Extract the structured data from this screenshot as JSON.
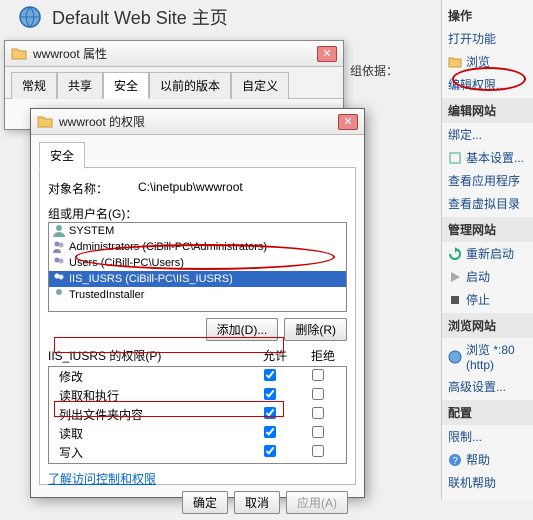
{
  "main": {
    "title": "Default Web Site 主页"
  },
  "depends_text": "组依据：",
  "props_dialog": {
    "title": "wwwroot 属性",
    "tabs": [
      "常规",
      "共享",
      "安全",
      "以前的版本",
      "自定义"
    ]
  },
  "perm_dialog": {
    "title": "wwwroot 的权限",
    "tab": "安全",
    "object_label": "对象名称：",
    "object_value": "C:\\inetpub\\wwwroot",
    "groups_label": "组或用户名(G)：",
    "groups": [
      {
        "name": "SYSTEM"
      },
      {
        "name": "Administrators (CiBill-PC\\Administrators)"
      },
      {
        "name": "Users (CiBill-PC\\Users)"
      },
      {
        "name": "IIS_IUSRS (CiBill-PC\\IIS_IUSRS)",
        "selected": true
      },
      {
        "name": "TrustedInstaller"
      }
    ],
    "add_btn": "添加(D)...",
    "remove_btn": "删除(R)",
    "perm_label_tpl": "IIS_IUSRS 的权限(P)",
    "col_allow": "允许",
    "col_deny": "拒绝",
    "perms": [
      {
        "name": "修改",
        "allow": true,
        "deny": false
      },
      {
        "name": "读取和执行",
        "allow": true,
        "deny": false
      },
      {
        "name": "列出文件夹内容",
        "allow": true,
        "deny": false
      },
      {
        "name": "读取",
        "allow": true,
        "deny": false
      },
      {
        "name": "写入",
        "allow": true,
        "deny": false
      }
    ],
    "learn_link": "了解访问控制和权限",
    "ok_btn": "确定",
    "cancel_btn": "取消",
    "apply_btn": "应用(A)"
  },
  "sidebar": {
    "header": "操作",
    "open_feature": "打开功能",
    "browse": "浏览",
    "edit_perm": "编辑权限...",
    "edit_site": "编辑网站",
    "bind": "绑定...",
    "basic": "基本设置...",
    "view_app": "查看应用程序",
    "view_vdir": "查看虚拟目录",
    "manage_site": "管理网站",
    "restart": "重新启动",
    "start": "启动",
    "stop": "停止",
    "browse_site": "浏览网站",
    "browse_80": "浏览 *:80 (http)",
    "adv": "高级设置...",
    "config": "配置",
    "limits": "限制...",
    "help": "帮助",
    "online_help": "联机帮助"
  }
}
